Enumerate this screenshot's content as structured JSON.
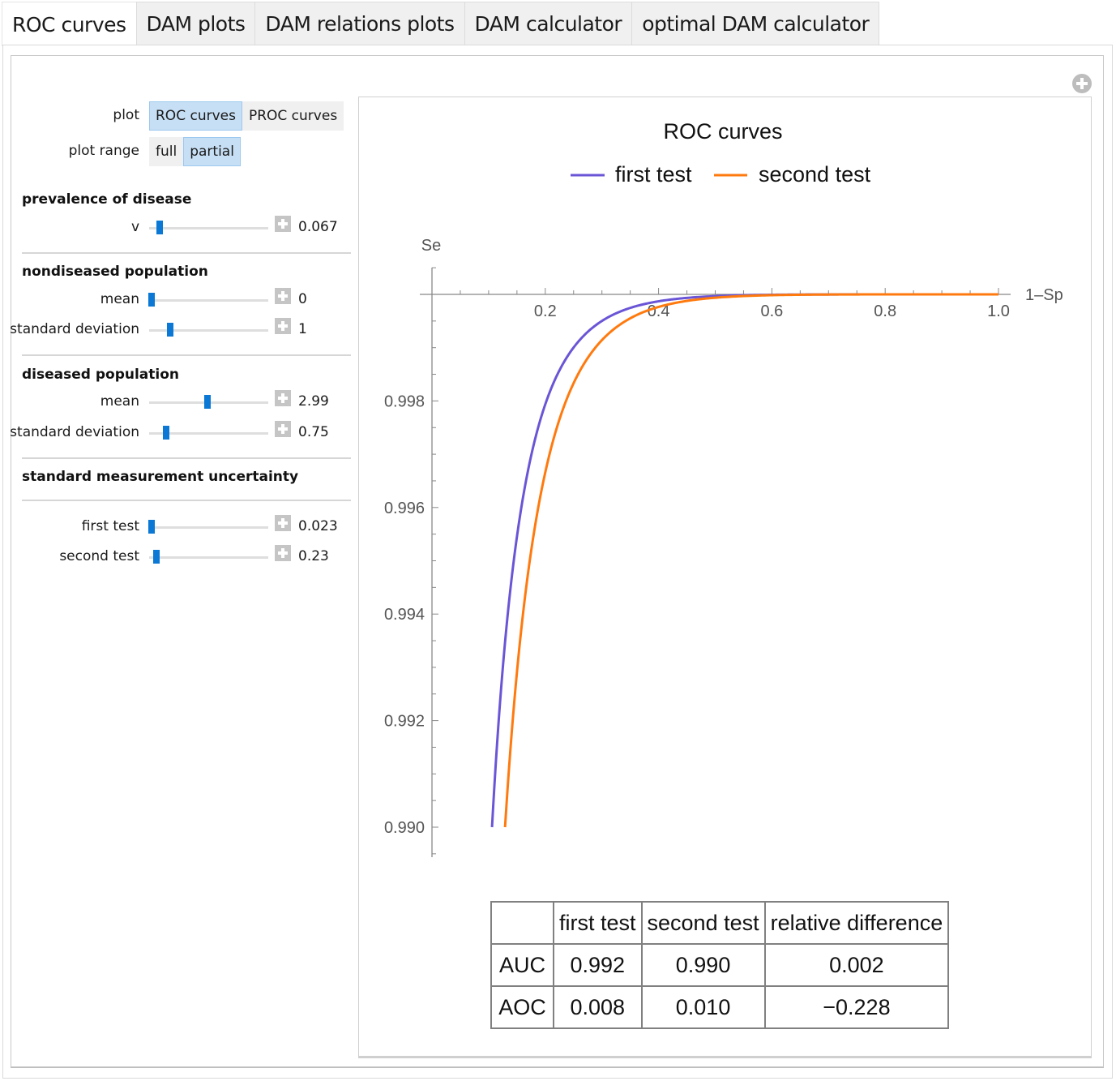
{
  "tabs": [
    {
      "label": "ROC curves",
      "active": true
    },
    {
      "label": "DAM plots",
      "active": false
    },
    {
      "label": "DAM relations plots",
      "active": false
    },
    {
      "label": "DAM calculator",
      "active": false
    },
    {
      "label": "optimal DAM calculator",
      "active": false
    }
  ],
  "icons": {
    "corner_expand": "plus-circle-icon",
    "slider_expand": "plus-square-icon"
  },
  "controls": {
    "plot": {
      "label": "plot",
      "options": [
        "ROC curves",
        "PROC curves"
      ],
      "selected": "ROC curves"
    },
    "plot_range": {
      "label": "plot range",
      "options": [
        "full",
        "partial"
      ],
      "selected": "partial"
    },
    "prevalence": {
      "title": "prevalence of disease",
      "sliders": [
        {
          "label": "v",
          "value": "0.067",
          "fraction": 0.09
        }
      ]
    },
    "nondiseased": {
      "title": "nondiseased population",
      "sliders": [
        {
          "label": "mean",
          "value": "0",
          "fraction": 0.02
        },
        {
          "label": "standard deviation",
          "value": "1",
          "fraction": 0.18
        }
      ]
    },
    "diseased": {
      "title": "diseased population",
      "sliders": [
        {
          "label": "mean",
          "value": "2.99",
          "fraction": 0.49
        },
        {
          "label": "standard deviation",
          "value": "0.75",
          "fraction": 0.14
        }
      ]
    },
    "uncertainty": {
      "title": "standard measurement uncertainty",
      "sliders": [
        {
          "label": "first test",
          "value": "0.023",
          "fraction": 0.02
        },
        {
          "label": "second test",
          "value": "0.23",
          "fraction": 0.06
        }
      ]
    }
  },
  "chart_data": {
    "type": "line",
    "title": "ROC curves",
    "xlabel": "1–Sp",
    "ylabel": "Se",
    "xlim": [
      0,
      1.0
    ],
    "ylim": [
      0.989,
      1.0003
    ],
    "x_ticks": [
      "0.2",
      "0.4",
      "0.6",
      "0.8",
      "1.0"
    ],
    "x_tick_values": [
      0.2,
      0.4,
      0.6,
      0.8,
      1.0
    ],
    "y_ticks": [
      "0.990",
      "0.992",
      "0.994",
      "0.996",
      "0.998"
    ],
    "y_tick_values": [
      0.99,
      0.992,
      0.994,
      0.996,
      0.998
    ],
    "grid": false,
    "legend": "top-center",
    "series": [
      {
        "name": "first test",
        "color": "#6a55d6",
        "x": [
          0.106,
          0.115,
          0.125,
          0.14,
          0.16,
          0.18,
          0.2,
          0.23,
          0.26,
          0.3,
          0.35,
          0.4,
          0.45,
          0.5,
          0.6,
          0.7,
          0.8,
          0.9,
          1.0
        ],
        "y": [
          0.99,
          0.992,
          0.9938,
          0.9955,
          0.997,
          0.998,
          0.99865,
          0.99925,
          0.99957,
          0.99978,
          0.9999,
          0.99995,
          0.99998,
          0.99999,
          1.0,
          1.0,
          1.0,
          1.0,
          1.0
        ]
      },
      {
        "name": "second test",
        "color": "#ff7a0e",
        "x": [
          0.129,
          0.138,
          0.148,
          0.163,
          0.183,
          0.205,
          0.23,
          0.26,
          0.29,
          0.33,
          0.38,
          0.43,
          0.48,
          0.53,
          0.6,
          0.7,
          0.8,
          0.9,
          1.0
        ],
        "y": [
          0.99,
          0.992,
          0.9938,
          0.9955,
          0.997,
          0.998,
          0.99865,
          0.99925,
          0.99957,
          0.99978,
          0.9999,
          0.99995,
          0.99998,
          0.99999,
          1.0,
          1.0,
          1.0,
          1.0,
          1.0
        ]
      }
    ]
  },
  "results_table": {
    "headers": [
      "",
      "first test",
      "second test",
      "relative difference"
    ],
    "rows": [
      [
        "AUC",
        "0.992",
        "0.990",
        "0.002"
      ],
      [
        "AOC",
        "0.008",
        "0.010",
        "−0.228"
      ]
    ]
  }
}
